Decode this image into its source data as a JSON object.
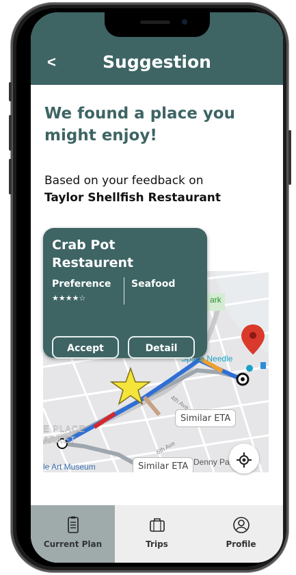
{
  "header": {
    "back_label": "<",
    "title": "Suggestion"
  },
  "main": {
    "headline": "We found a place you might enjoy!",
    "feedback_prefix": "Based on your feedback on",
    "feedback_restaurant": "Taylor Shellfish Restaurant"
  },
  "card": {
    "name": "Crab Pot Restaurent",
    "preference_label": "Preference",
    "category": "Seafood",
    "rating_stars": "★★★★☆",
    "rating": 4,
    "accept_label": "Accept",
    "detail_label": "Detail"
  },
  "map": {
    "labels": {
      "park": "ark",
      "space_needle": "Space Needle",
      "place_market_1": "E PLACE",
      "place_market_2": "ARKET",
      "art_museum": "le Art Museum",
      "denny_park": "Denny Park",
      "ave1": "4th Ave",
      "ave2": "6th Ave"
    },
    "eta_bubbles": [
      "Similar ETA",
      "Similar ETA"
    ],
    "route_color": "#2f6fd6",
    "pin_color": "#d93a2b",
    "star_color": "#f5e43a",
    "locate_icon": "crosshair-icon"
  },
  "tabbar": {
    "tabs": [
      {
        "label": "Current Plan",
        "icon": "clipboard-icon",
        "active": true
      },
      {
        "label": "Trips",
        "icon": "briefcase-icon",
        "active": false
      },
      {
        "label": "Profile",
        "icon": "user-icon",
        "active": false
      }
    ]
  },
  "colors": {
    "accent": "#3e6464",
    "tab_active": "#9fabab"
  }
}
